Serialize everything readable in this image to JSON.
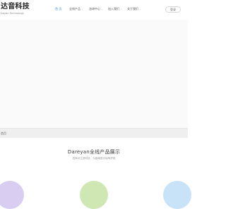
{
  "brand": {
    "name_cn": "达音科技",
    "name_en": "Dayan Technology"
  },
  "nav": {
    "items": [
      {
        "label": "首 页",
        "active": true,
        "has_caret": false
      },
      {
        "label": "全线产品",
        "active": false,
        "has_caret": true
      },
      {
        "label": "咨询中心",
        "active": false,
        "has_caret": true
      },
      {
        "label": "加入我们",
        "active": false,
        "has_caret": true
      },
      {
        "label": "关于我们",
        "active": false,
        "has_caret": true
      }
    ],
    "caret_glyph": "⌄",
    "login_label": "登录"
  },
  "breadcrumb": {
    "text": "首页"
  },
  "products_section": {
    "title": "Dareyan全线产品展示",
    "subtitle": "选择对达音科技，为高端音乐保驾护航"
  },
  "colors": {
    "accent": "#2e8fd8",
    "circle_purple": "#d9cdf2",
    "circle_green": "#cfe7b2",
    "circle_blue": "#c8e3f7"
  }
}
